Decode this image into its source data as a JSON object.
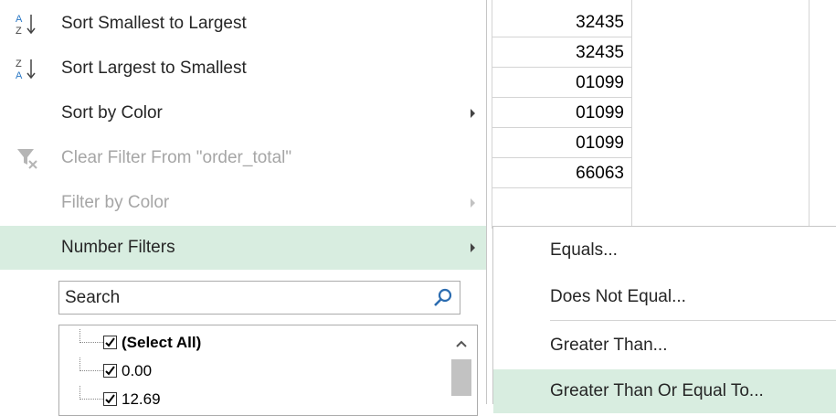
{
  "sheet": {
    "values": [
      "32435",
      "32435",
      "01099",
      "01099",
      "01099",
      "66063"
    ]
  },
  "menu": {
    "sort_asc": "Sort Smallest to Largest",
    "sort_desc": "Sort Largest to Smallest",
    "sort_color": "Sort by Color",
    "clear_filter": "Clear Filter From \"order_total\"",
    "filter_color": "Filter by Color",
    "number_filters": "Number Filters",
    "search_placeholder": "Search",
    "list_items": [
      "(Select All)",
      "0.00",
      "12.69"
    ]
  },
  "submenu": {
    "items": [
      "Equals...",
      "Does Not Equal...",
      "Greater Than...",
      "Greater Than Or Equal To..."
    ]
  },
  "colors": {
    "highlight": "#d8ede0",
    "disabled_text": "#a6a6a6"
  },
  "icons": {
    "sort_asc": "sort-a-to-z-icon",
    "sort_desc": "sort-z-to-a-icon",
    "clear_filter": "clear-filter-icon",
    "search": "magnifier-icon",
    "submenu": "chevron-right-icon"
  }
}
